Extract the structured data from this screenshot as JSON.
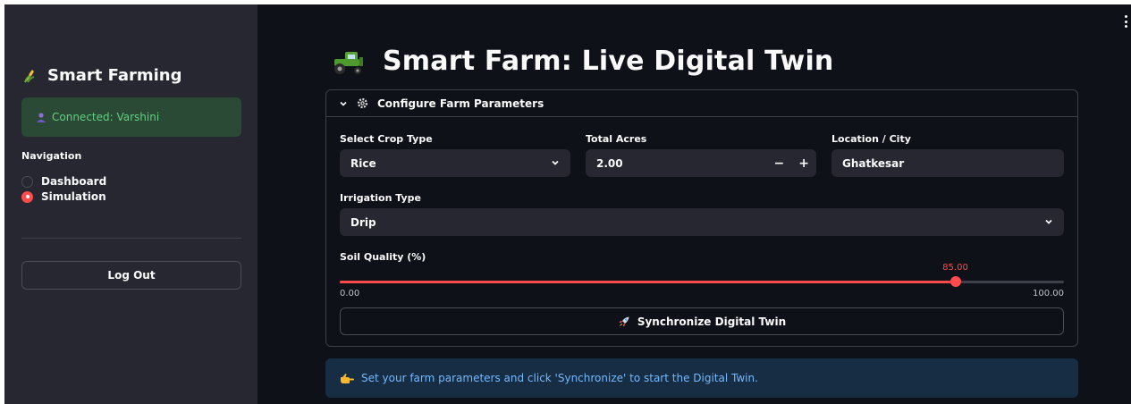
{
  "sidebar": {
    "brand_title": "Smart Farming",
    "connection_status": "Connected: Varshini",
    "navigation_label": "Navigation",
    "nav_options": [
      {
        "label": "Dashboard",
        "selected": false
      },
      {
        "label": "Simulation",
        "selected": true
      }
    ],
    "logout_label": "Log Out"
  },
  "main": {
    "title": "Smart Farm: Live Digital Twin",
    "expander_title": "Configure Farm Parameters",
    "fields": {
      "crop": {
        "label": "Select Crop Type",
        "value": "Rice"
      },
      "acres": {
        "label": "Total Acres",
        "value": "2.00",
        "minus": "−",
        "plus": "+"
      },
      "location": {
        "label": "Location / City",
        "value": "Ghatkesar"
      },
      "irrigation": {
        "label": "Irrigation Type",
        "value": "Drip"
      }
    },
    "soil": {
      "label": "Soil Quality (%)",
      "value_text": "85.00",
      "min_text": "0.00",
      "max_text": "100.00",
      "value": 85,
      "min": 0,
      "max": 100
    },
    "sync_label": "Synchronize Digital Twin",
    "info_text": "Set your farm parameters and click 'Synchronize' to start the Digital Twin."
  },
  "colors": {
    "accent": "#ff4b4b",
    "success_text": "#5fd17f",
    "info_text": "#73b8ff"
  },
  "icons": {
    "brand": "corn-icon",
    "connection": "user-icon",
    "title": "tractor-icon",
    "expander": "gear-icon",
    "sync": "rocket-icon",
    "info": "pointing-hand-icon"
  }
}
